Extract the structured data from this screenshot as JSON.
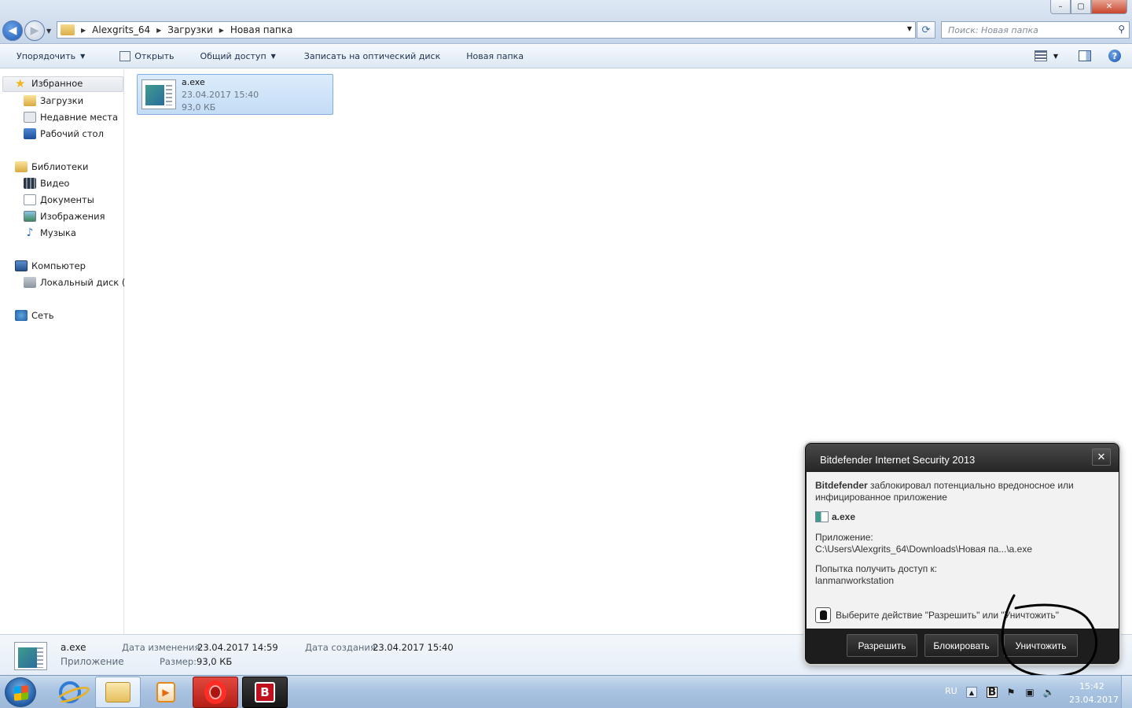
{
  "window": {
    "controls": {
      "minimize": "–",
      "maximize": "▢",
      "close": "✕"
    }
  },
  "address": {
    "breadcrumbs": [
      "Alexgrits_64",
      "Загрузки",
      "Новая папка"
    ],
    "search_placeholder": "Поиск: Новая папка"
  },
  "toolbar": {
    "organize": "Упорядочить",
    "open": "Открыть",
    "share": "Общий доступ",
    "burn": "Записать на оптический диск",
    "new_folder": "Новая папка"
  },
  "sidebar": {
    "favorites": "Избранное",
    "downloads": "Загрузки",
    "recent": "Недавние места",
    "desktop": "Рабочий стол",
    "libraries": "Библиотеки",
    "video": "Видео",
    "documents": "Документы",
    "pictures": "Изображения",
    "music": "Музыка",
    "computer": "Компьютер",
    "local_disk": "Локальный диск (C",
    "network": "Сеть"
  },
  "file": {
    "name": "a.exe",
    "date": "23.04.2017 15:40",
    "size": "93,0 КБ"
  },
  "details": {
    "name": "a.exe",
    "type": "Приложение",
    "modified_label": "Дата изменения:",
    "modified_value": "23.04.2017 14:59",
    "size_label": "Размер:",
    "size_value": "93,0 КБ",
    "created_label": "Дата создания:",
    "created_value": "23.04.2017 15:40"
  },
  "popup": {
    "title": "Bitdefender Internet Security 2013",
    "close": "✕",
    "brand": "Bitdefender",
    "message_line1": " заблокировал потенциально вредоносное или",
    "message_line2": "инфицированное приложение",
    "file_name": "a.exe",
    "app_label": "Приложение:",
    "app_path": "C:\\Users\\Alexgrits_64\\Downloads\\Новая па...\\a.exe",
    "access_label": "Попытка получить доступ к:",
    "access_value": "lanmanworkstation",
    "action_prompt": "Выберите действие \"Разрешить\" или \"Уничтожить\"",
    "buttons": {
      "allow": "Разрешить",
      "block": "Блокировать",
      "destroy": "Уничтожить"
    }
  },
  "tray": {
    "language": "RU",
    "time": "15:42",
    "date": "23.04.2017"
  },
  "taskbar": {
    "bitdefender_letter": "B"
  }
}
